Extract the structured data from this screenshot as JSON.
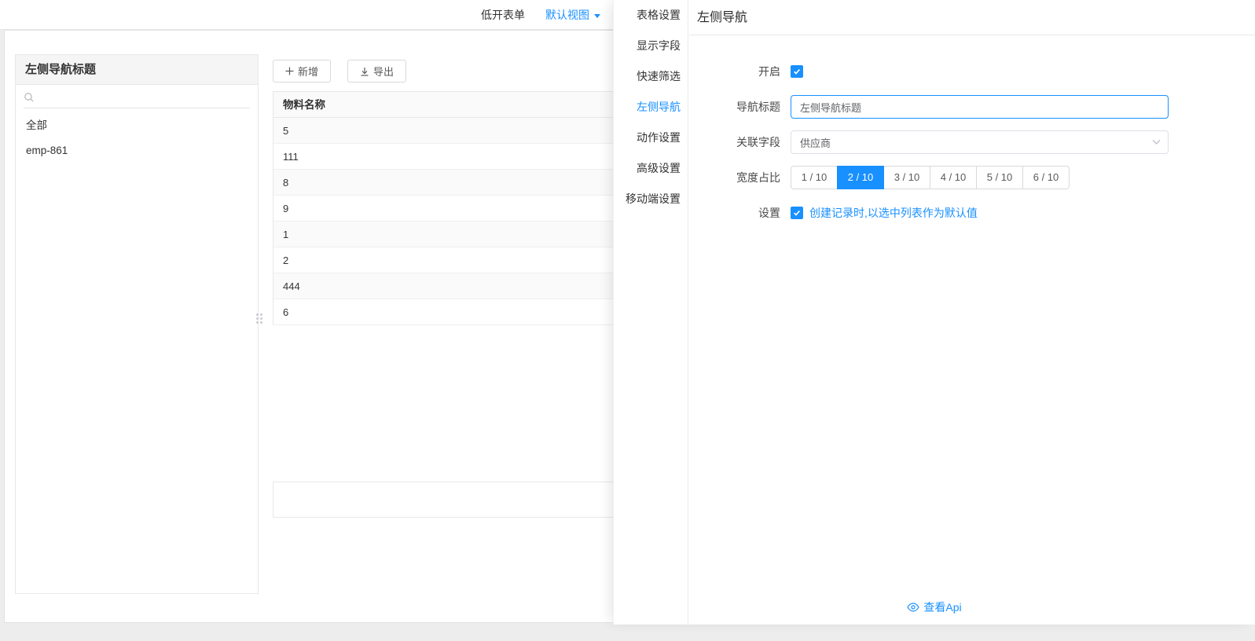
{
  "colors": {
    "primary": "#1890ff"
  },
  "topbar": {
    "tabs": [
      {
        "label": "低开表单"
      },
      {
        "label": "默认视图"
      }
    ]
  },
  "left_panel": {
    "title": "左侧导航标题",
    "search_placeholder": "",
    "items": [
      "全部",
      "emp-861"
    ]
  },
  "toolbar": {
    "add": "新增",
    "export": "导出"
  },
  "table": {
    "columns": [
      "物料名称"
    ],
    "rows": [
      "5",
      "111",
      "8",
      "9",
      "1",
      "2",
      "444",
      "6"
    ]
  },
  "drawer": {
    "menu": [
      "表格设置",
      "显示字段",
      "快速筛选",
      "左侧导航",
      "动作设置",
      "高级设置",
      "移动端设置"
    ],
    "title": "左侧导航",
    "form": {
      "enable_label": "开启",
      "enable_checked": true,
      "title_label": "导航标题",
      "title_value": "左侧导航标题",
      "field_label": "关联字段",
      "field_value": "供应商",
      "width_label": "宽度占比",
      "width_options": [
        "1 / 10",
        "2 / 10",
        "3 / 10",
        "4 / 10",
        "5 / 10",
        "6 / 10"
      ],
      "width_selected": "2 / 10",
      "settings_label": "设置",
      "settings_checked": true,
      "settings_option": "创建记录时,以选中列表作为默认值"
    },
    "footer_link": "查看Api"
  }
}
